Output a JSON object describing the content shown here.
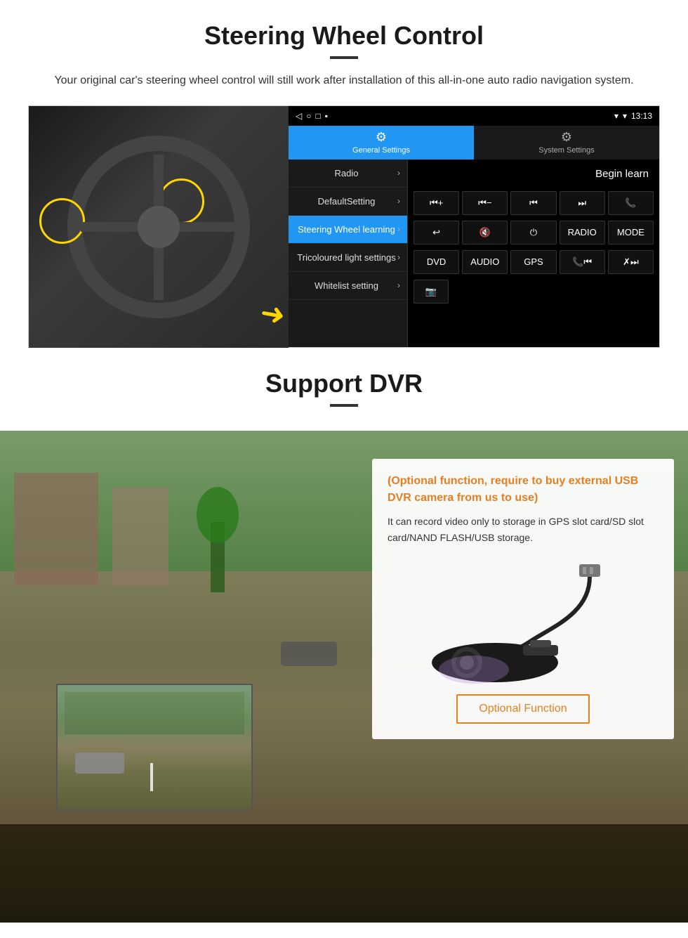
{
  "section1": {
    "title": "Steering Wheel Control",
    "description": "Your original car's steering wheel control will still work after installation of this all-in-one auto radio navigation system.",
    "statusbar": {
      "time": "13:13",
      "signal": "▼",
      "wifi": "▾"
    },
    "tabs": [
      {
        "id": "general",
        "label": "General Settings",
        "active": true
      },
      {
        "id": "system",
        "label": "System Settings",
        "active": false
      }
    ],
    "menu_items": [
      {
        "label": "Radio",
        "active": false
      },
      {
        "label": "DefaultSetting",
        "active": false
      },
      {
        "label": "Steering Wheel learning",
        "active": true
      },
      {
        "label": "Tricoloured light settings",
        "active": false
      },
      {
        "label": "Whitelist setting",
        "active": false
      }
    ],
    "begin_learn": "Begin learn",
    "control_buttons_row1": [
      "⏮+",
      "⏮-",
      "⏮",
      "⏭",
      "📞"
    ],
    "control_buttons_row2": [
      "↩",
      "🔇x",
      "⏻",
      "RADIO",
      "MODE"
    ],
    "control_buttons_row3": [
      "DVD",
      "AUDIO",
      "GPS",
      "📞⏮",
      "✗⏭"
    ],
    "control_buttons_row4": [
      "📷"
    ]
  },
  "section2": {
    "title": "Support DVR",
    "optional_title": "(Optional function, require to buy external USB DVR camera from us to use)",
    "description": "It can record video only to storage in GPS slot card/SD slot card/NAND FLASH/USB storage.",
    "optional_function_btn": "Optional Function"
  }
}
